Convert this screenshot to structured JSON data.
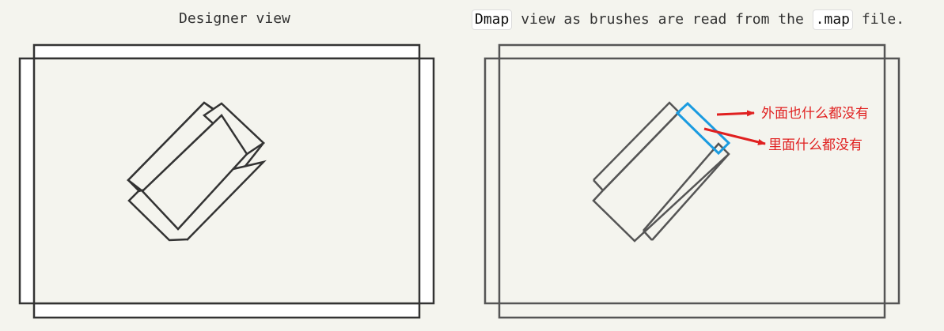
{
  "captions": {
    "left": "Designer view",
    "right_code1": "Dmap",
    "right_mid": " view as brushes are read from the ",
    "right_code2": ".map",
    "right_end": " file."
  },
  "annotations": {
    "outside": "外面也什么都没有",
    "inside": "里面什么都没有"
  },
  "colors": {
    "background": "#f4f4ee",
    "stroke": "#333333",
    "highlight": "#1a9be0",
    "arrow": "#e02020"
  }
}
